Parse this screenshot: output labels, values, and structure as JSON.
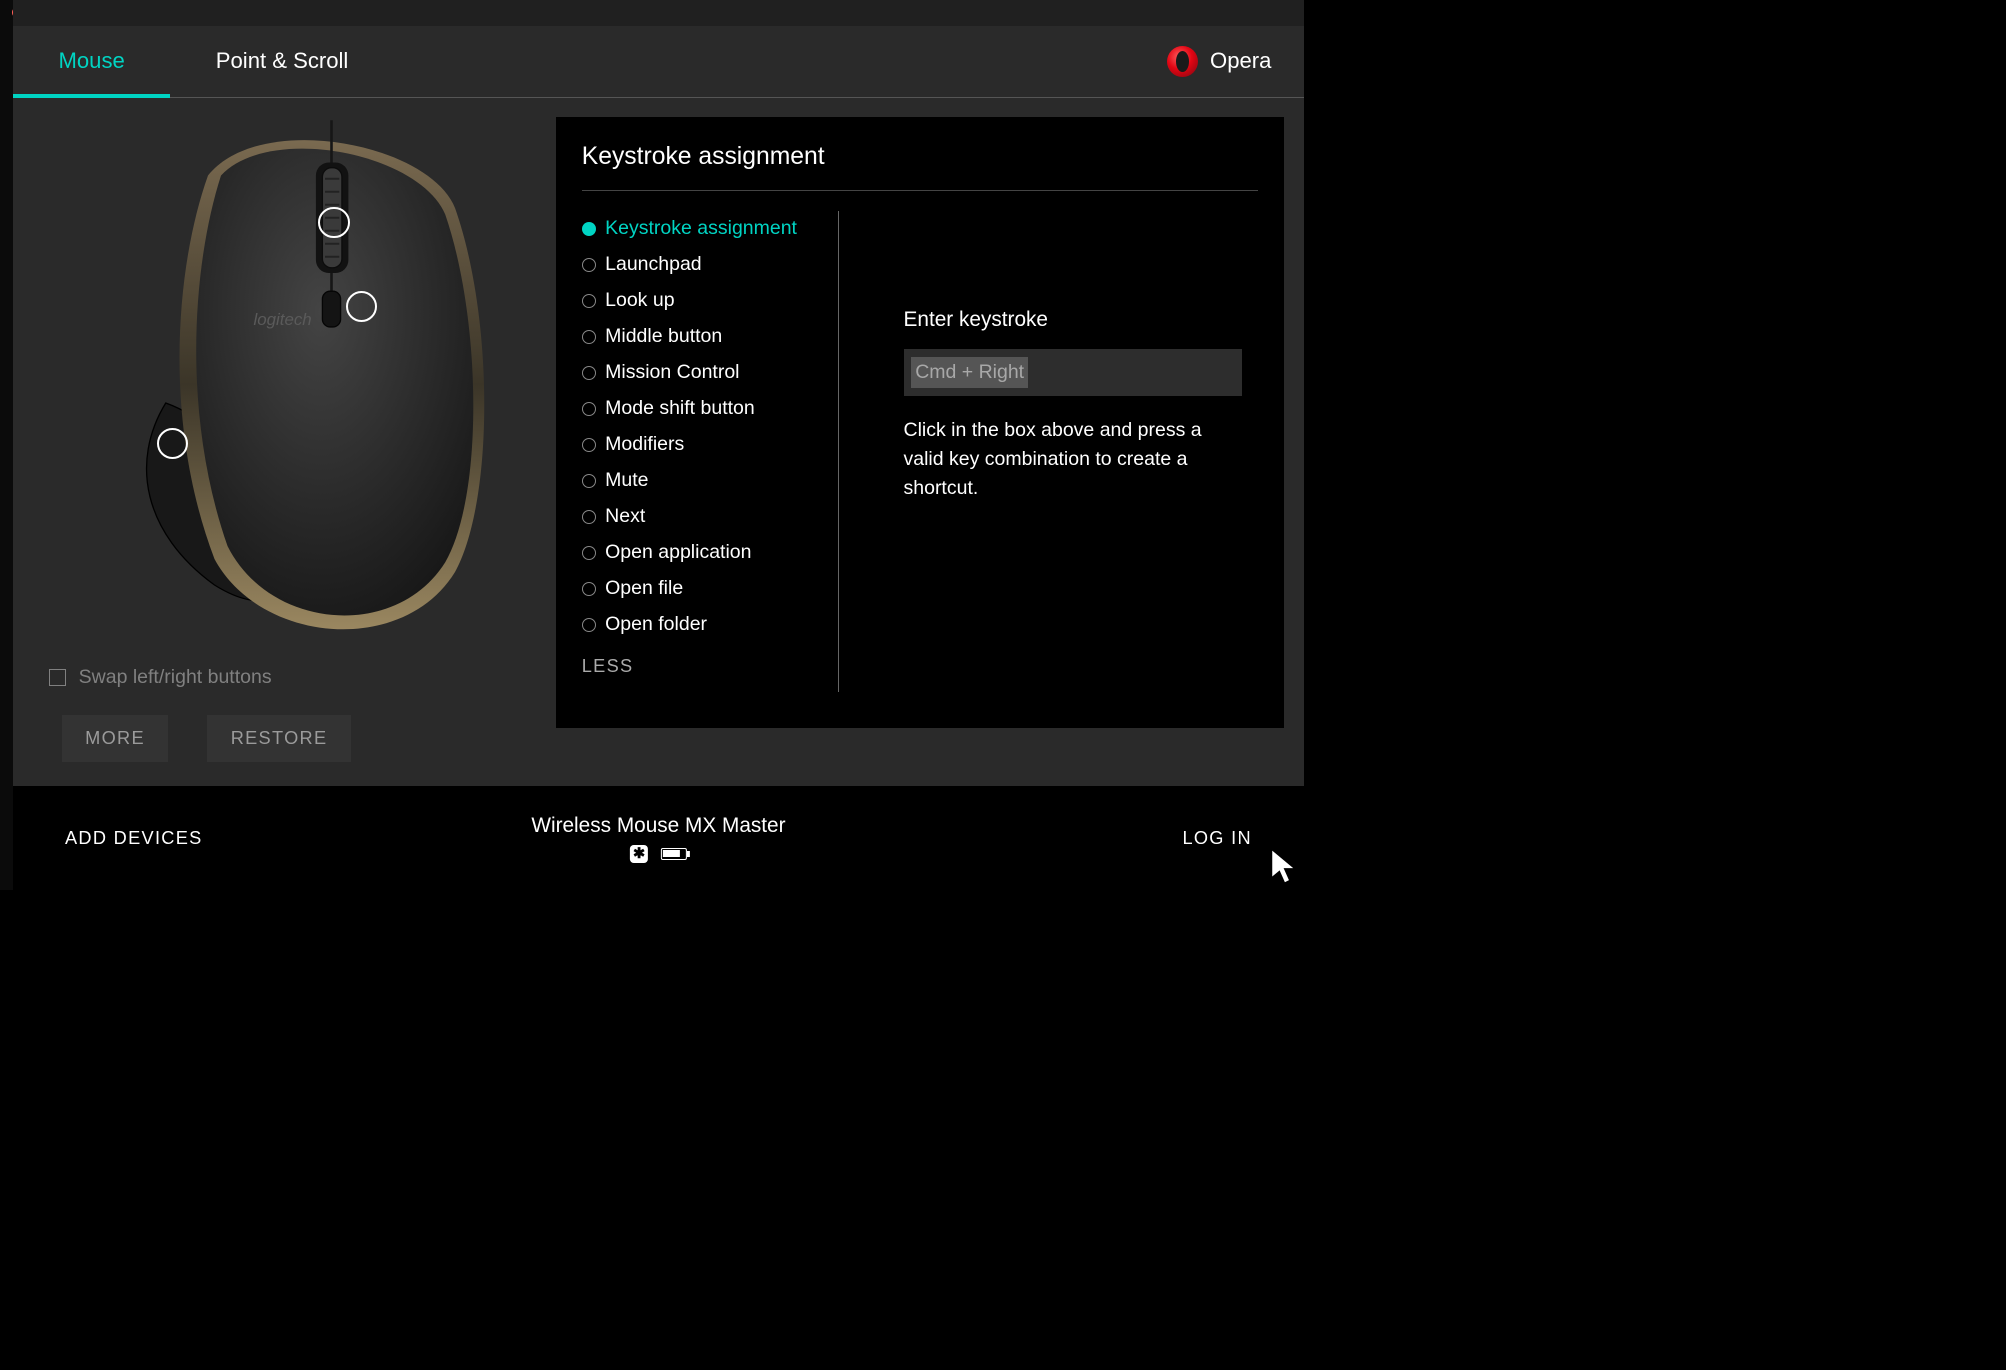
{
  "tabs": {
    "mouse": "Mouse",
    "point_scroll": "Point & Scroll"
  },
  "app_profile": {
    "name": "Opera"
  },
  "swap_label": "Swap left/right buttons",
  "buttons": {
    "more": "MORE",
    "restore": "RESTORE"
  },
  "panel": {
    "title": "Keystroke assignment",
    "options": [
      "Keystroke assignment",
      "Launchpad",
      "Look up",
      "Middle button",
      "Mission Control",
      "Mode shift button",
      "Modifiers",
      "Mute",
      "Next",
      "Open application",
      "Open file",
      "Open folder"
    ],
    "selected_index": 0,
    "less": "LESS",
    "config_label": "Enter keystroke",
    "config_value": "Cmd + Right",
    "config_help": "Click in the box above and press a valid key combination to create a shortcut."
  },
  "footer": {
    "add_devices": "ADD DEVICES",
    "device_name": "Wireless Mouse MX Master",
    "login": "LOG IN"
  },
  "mouse_brand": "logitech"
}
